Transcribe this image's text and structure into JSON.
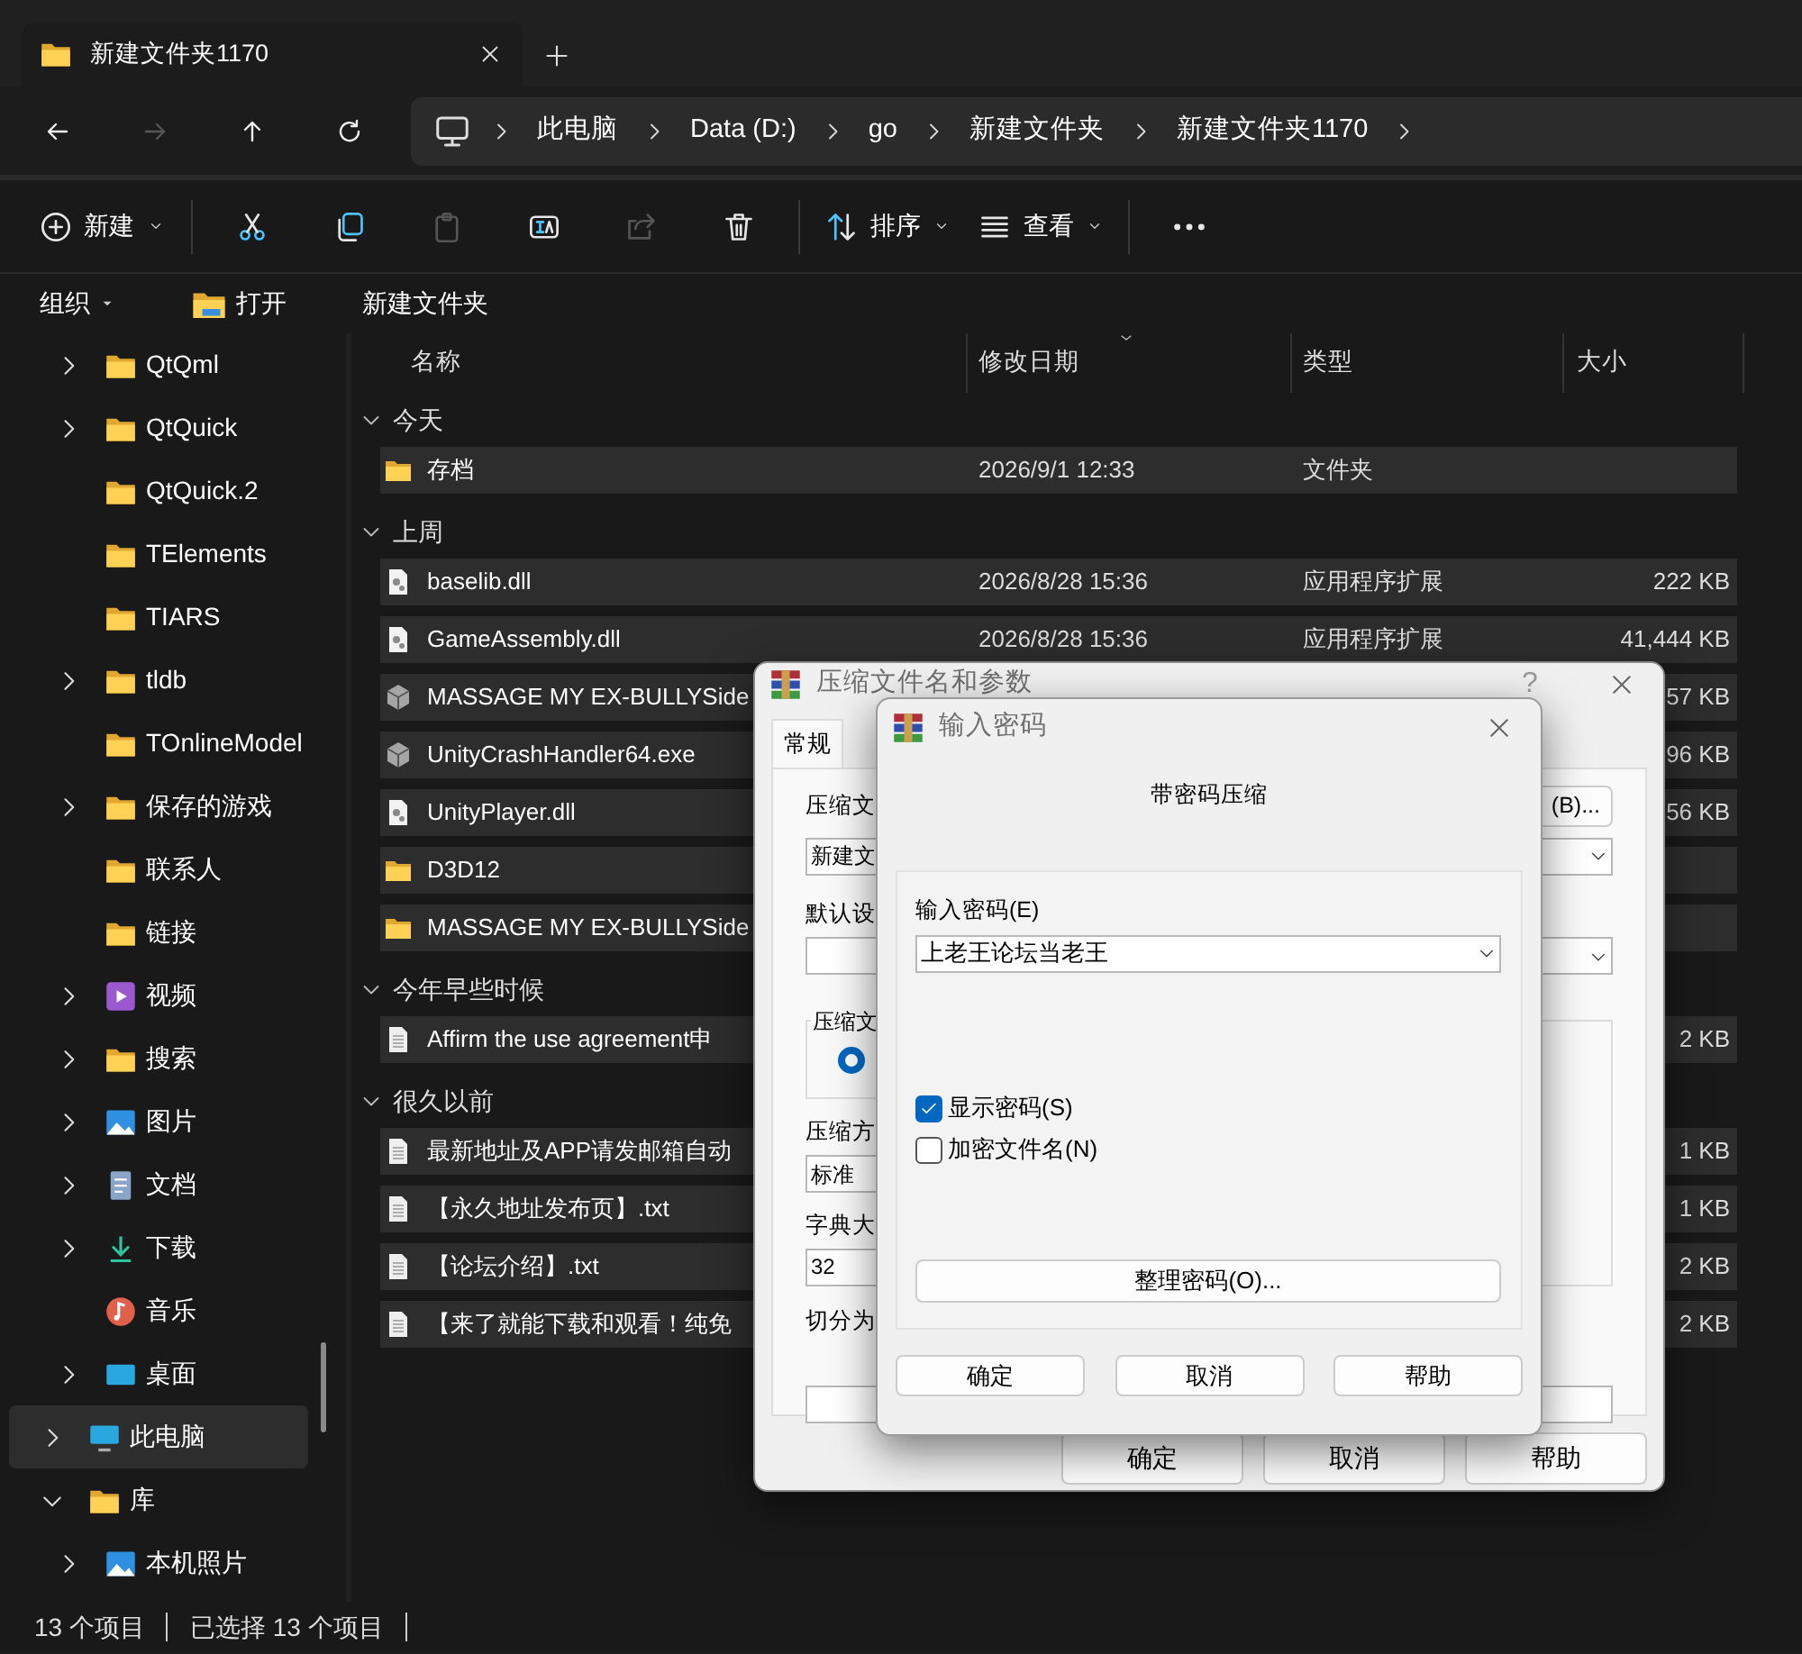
{
  "explorer": {
    "tab": {
      "title": "新建文件夹1170",
      "selected": true
    },
    "nav": [
      {
        "kind": "back",
        "disabled": false
      },
      {
        "kind": "forward",
        "disabled": true
      },
      {
        "kind": "up",
        "disabled": false
      },
      {
        "kind": "refresh",
        "disabled": false
      }
    ],
    "breadcrumb": [
      "此电脑",
      "Data (D:)",
      "go",
      "新建文件夹",
      "新建文件夹1170"
    ],
    "toolbar": [
      {
        "kind": "new",
        "label": "新建",
        "disabled": false
      },
      {
        "kind": "separator"
      },
      {
        "kind": "cut",
        "disabled": false
      },
      {
        "kind": "copy",
        "disabled": false
      },
      {
        "kind": "paste",
        "disabled": true
      },
      {
        "kind": "rename",
        "disabled": false
      },
      {
        "kind": "share",
        "disabled": true
      },
      {
        "kind": "delete",
        "disabled": false
      },
      {
        "kind": "separator"
      },
      {
        "kind": "sort",
        "label": "排序",
        "disabled": false
      },
      {
        "kind": "view",
        "label": "查看",
        "disabled": false
      },
      {
        "kind": "separator"
      },
      {
        "kind": "more",
        "disabled": false
      }
    ],
    "command_bar": [
      {
        "kind": "menu",
        "label": "组织"
      },
      {
        "kind": "open",
        "label": "打开"
      },
      {
        "kind": "plain",
        "label": "新建文件夹"
      }
    ],
    "sidebar": {
      "upper_items": [
        {
          "label": "QtQml",
          "kind": "folder",
          "expandable": true,
          "selected": false
        },
        {
          "label": "QtQuick",
          "kind": "folder",
          "expandable": true,
          "selected": false
        },
        {
          "label": "QtQuick.2",
          "kind": "folder",
          "expandable": false,
          "selected": false
        },
        {
          "label": "TElements",
          "kind": "folder",
          "expandable": false,
          "selected": false
        },
        {
          "label": "TIARS",
          "kind": "folder",
          "expandable": false,
          "selected": false
        },
        {
          "label": "tldb",
          "kind": "folder",
          "expandable": true,
          "selected": false
        },
        {
          "label": "TOnlineModel",
          "kind": "folder",
          "expandable": false,
          "selected": false
        },
        {
          "label": "保存的游戏",
          "kind": "folder",
          "expandable": true,
          "selected": false
        },
        {
          "label": "联系人",
          "kind": "folder",
          "expandable": false,
          "selected": false
        },
        {
          "label": "链接",
          "kind": "folder",
          "expandable": false,
          "selected": false
        },
        {
          "label": "视频",
          "kind": "video",
          "expandable": true,
          "selected": false
        },
        {
          "label": "搜索",
          "kind": "folder",
          "expandable": true,
          "selected": false
        },
        {
          "label": "图片",
          "kind": "picture",
          "expandable": true,
          "selected": false
        },
        {
          "label": "文档",
          "kind": "document",
          "expandable": true,
          "selected": false
        },
        {
          "label": "下载",
          "kind": "download",
          "expandable": true,
          "selected": false
        },
        {
          "label": "音乐",
          "kind": "music",
          "expandable": false,
          "selected": false
        },
        {
          "label": "桌面",
          "kind": "desktop",
          "expandable": true,
          "selected": false
        }
      ],
      "items": [
        {
          "label": "此电脑",
          "kind": "computer",
          "expandable": true,
          "expanded": false,
          "selected": true
        },
        {
          "label": "库",
          "kind": "folder",
          "expandable": true,
          "expanded": true,
          "selected": false,
          "children": [
            {
              "label": "本机照片",
              "kind": "picture",
              "expandable": true,
              "expanded": false,
              "selected": false
            }
          ]
        }
      ]
    },
    "columns": [
      {
        "label": "名称",
        "sorted": false
      },
      {
        "label": "修改日期",
        "sorted": true
      },
      {
        "label": "类型",
        "sorted": false
      },
      {
        "label": "大小",
        "sorted": false
      }
    ],
    "groups": [
      {
        "label": "今天",
        "expanded": true,
        "rows": [
          {
            "name": "存档",
            "kind": "folder",
            "date": "2026/9/1 12:33",
            "type": "文件夹",
            "selected": true
          }
        ]
      },
      {
        "label": "上周",
        "expanded": true,
        "rows": [
          {
            "name": "baselib.dll",
            "kind": "dll",
            "date": "2026/8/28 15:36",
            "type": "应用程序扩展",
            "size": "222 KB",
            "selected": true
          },
          {
            "name": "GameAssembly.dll",
            "kind": "dll",
            "date": "2026/8/28 15:36",
            "type": "应用程序扩展",
            "size": "41,444 KB",
            "selected": true
          },
          {
            "name": "MASSAGE MY EX-BULLYSide",
            "kind": "exe",
            "size": "57 KB",
            "selected": true
          },
          {
            "name": "UnityCrashHandler64.exe",
            "kind": "exe",
            "size": "96 KB",
            "selected": true
          },
          {
            "name": "UnityPlayer.dll",
            "kind": "dll",
            "size": "56 KB",
            "selected": true
          },
          {
            "name": "D3D12",
            "kind": "folder",
            "selected": true
          },
          {
            "name": "MASSAGE MY EX-BULLYSide",
            "kind": "folder",
            "selected": true
          }
        ]
      },
      {
        "label": "今年早些时候",
        "expanded": true,
        "rows": [
          {
            "name": "Affirm the use agreement申",
            "kind": "text",
            "size": "2 KB",
            "selected": true
          }
        ]
      },
      {
        "label": "很久以前",
        "expanded": true,
        "rows": [
          {
            "name": "最新地址及APP请发邮箱自动",
            "kind": "text",
            "size": "1 KB",
            "selected": true
          },
          {
            "name": "【永久地址发布页】.txt",
            "kind": "text",
            "size": "1 KB",
            "selected": true
          },
          {
            "name": "【论坛介绍】.txt",
            "kind": "text",
            "size": "2 KB",
            "selected": true
          },
          {
            "name": "【来了就能下载和观看！纯免",
            "kind": "text",
            "size": "2 KB",
            "selected": true
          }
        ]
      }
    ],
    "status": [
      "13 个项目",
      "已选择 13 个项目"
    ]
  },
  "archive_dialog": {
    "title": "压缩文件名和参数",
    "help": "?",
    "tabs": [
      {
        "label": "常规",
        "selected": true
      }
    ],
    "archive_name_label": "压缩文",
    "browse_button": "(B)...",
    "archive_name": "新建文",
    "profile_label": "默认设",
    "format_label": "压缩文",
    "format_radio_checked": true,
    "method_label": "压缩方",
    "method": "标准",
    "dictionary_label": "字典大",
    "dictionary": "32",
    "split_label": "切分为",
    "buttons": [
      "确定",
      "取消",
      "帮助"
    ]
  },
  "password_dialog": {
    "title": "输入密码",
    "heading": "带密码压缩",
    "password_label": "输入密码(E)",
    "password": "上老王论坛当老王",
    "options": [
      {
        "label": "显示密码(S)",
        "checked": true
      },
      {
        "label": "加密文件名(N)",
        "checked": false
      }
    ],
    "organize_button": "整理密码(O)...",
    "buttons": [
      "确定",
      "取消",
      "帮助"
    ]
  }
}
